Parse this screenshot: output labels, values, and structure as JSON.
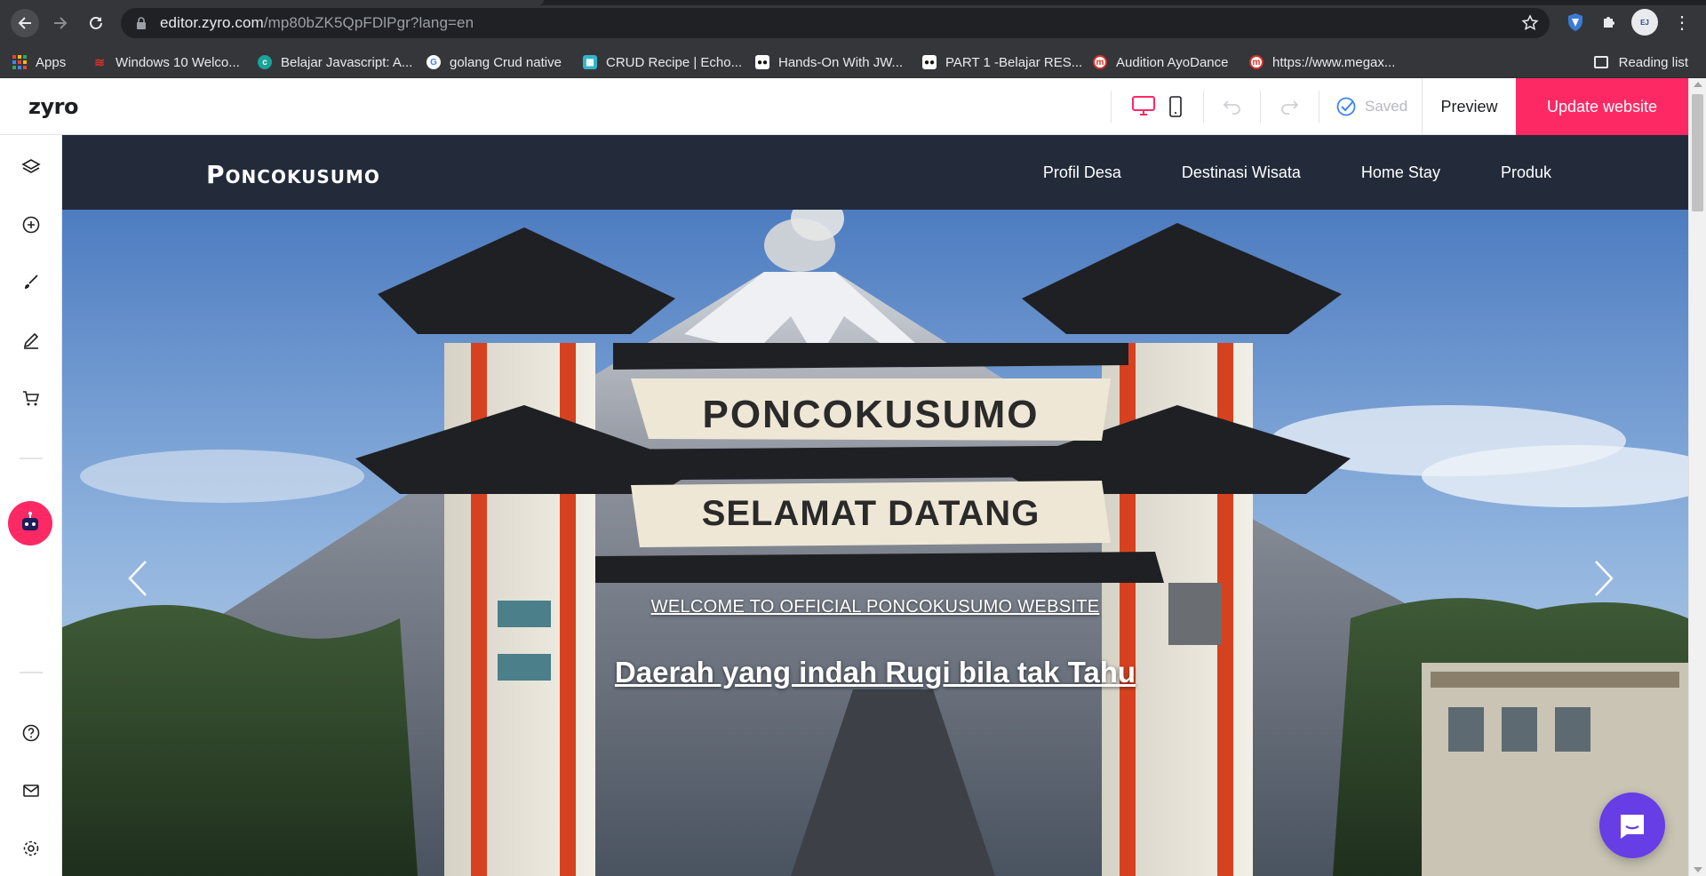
{
  "browser": {
    "url_host": "editor.zyro.com",
    "url_path": "/mp80bZK5QpFDlPgr?lang=en",
    "bookmarks": [
      {
        "label": "Apps",
        "icon": "apps-grid-icon",
        "color": "#ea4335"
      },
      {
        "label": "Windows 10 Welco...",
        "icon": "wifi-icon",
        "color": "#d93025"
      },
      {
        "label": "Belajar Javascript: A...",
        "icon": "codepolitan-icon",
        "color": "#1aa39a"
      },
      {
        "label": "golang Crud native",
        "icon": "google-icon",
        "color": "#4285f4"
      },
      {
        "label": "CRUD Recipe | Echo...",
        "icon": "echo-icon",
        "color": "#33b5c7"
      },
      {
        "label": "Hands-On With JW...",
        "icon": "medium-icon",
        "color": "#111111"
      },
      {
        "label": "PART 1 -Belajar RES...",
        "icon": "medium-icon",
        "color": "#111111"
      },
      {
        "label": "Audition AyoDance",
        "icon": "megaxus-icon",
        "color": "#d93025"
      },
      {
        "label": "https://www.megax...",
        "icon": "megaxus-icon",
        "color": "#d93025"
      }
    ],
    "reading_list": "Reading list"
  },
  "editor": {
    "logo": "zyro",
    "saved_label": "Saved",
    "preview_label": "Preview",
    "update_label": "Update website",
    "accent_color": "#fc2965"
  },
  "sidebar": {
    "icons": [
      "layers-icon",
      "add-element-icon",
      "design-brush-icon",
      "edit-pen-icon",
      "store-cart-icon",
      "ai-assistant-icon",
      "help-icon",
      "mail-icon",
      "settings-gear-icon"
    ]
  },
  "site": {
    "logo": "Poncokusumo",
    "nav": [
      "Profil Desa",
      "Destinasi Wisata",
      "Home Stay",
      "Produk"
    ],
    "hero": {
      "sign_top": "PONCOKUSUMO",
      "sign_bottom": "SELAMAT DATANG",
      "subtitle": "WELCOME TO OFFICIAL PONCOKUSUMO WEBSITE",
      "title": "Daerah yang indah Rugi bila tak Tahu"
    }
  }
}
